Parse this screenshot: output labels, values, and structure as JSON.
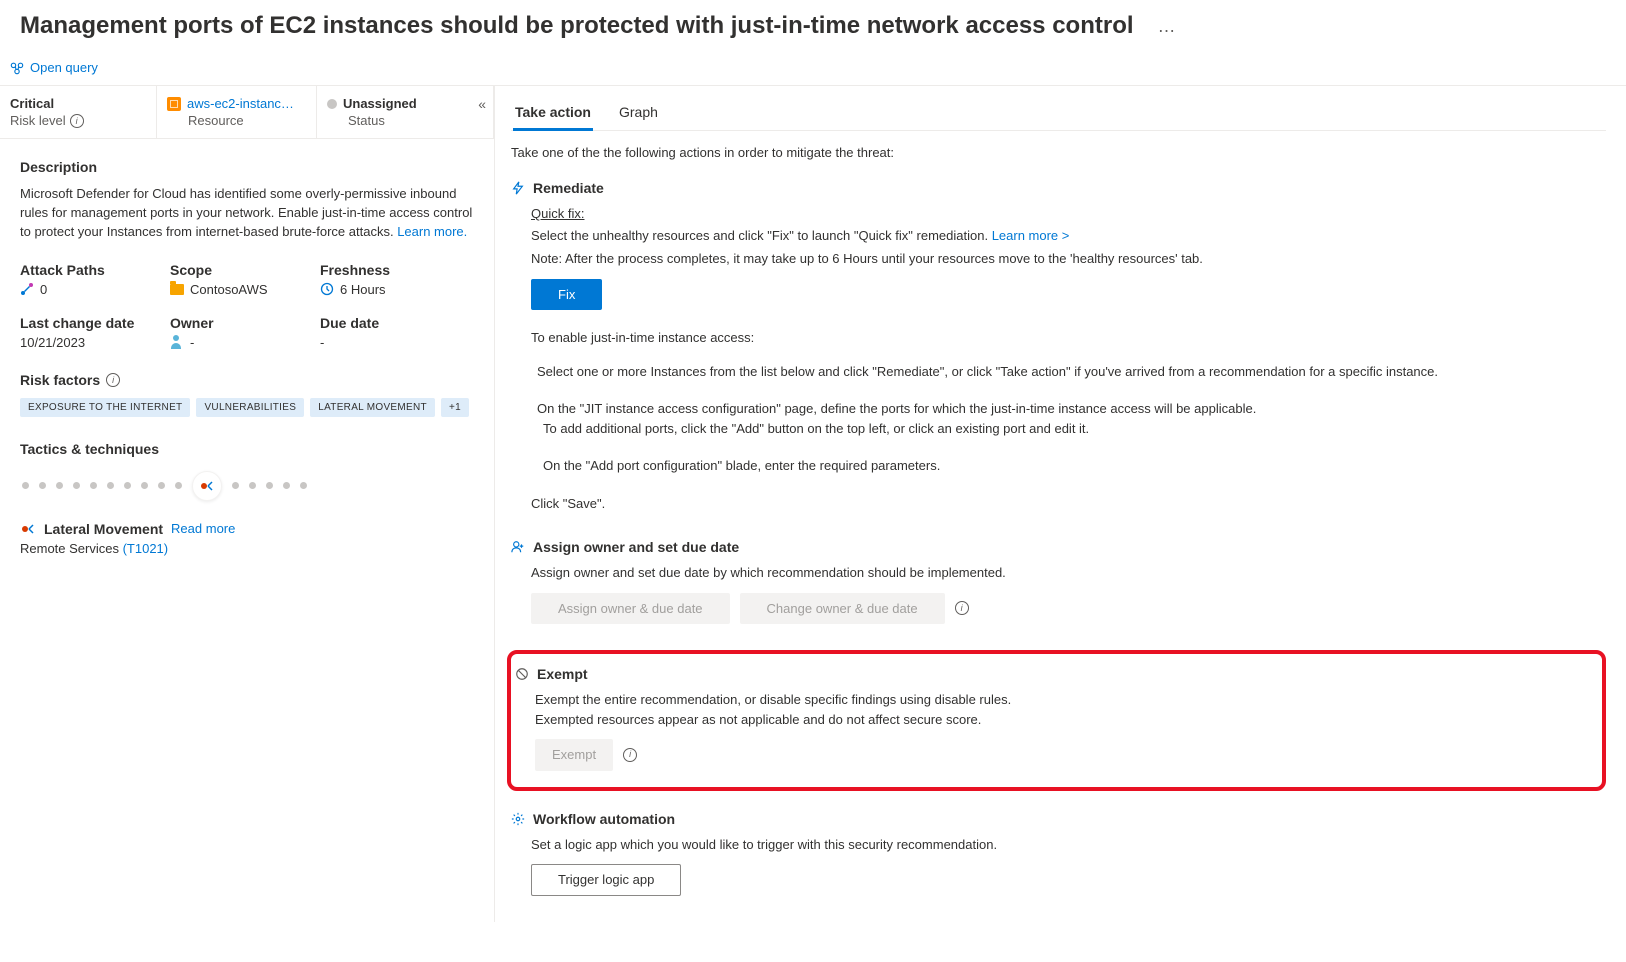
{
  "header": {
    "title": "Management ports of EC2 instances should be protected with just-in-time network access control",
    "ellipsis": "…",
    "open_query": "Open query"
  },
  "info_strip": {
    "risk_level": {
      "value": "Critical",
      "label": "Risk level"
    },
    "resource": {
      "value": "aws-ec2-instanc…",
      "label": "Resource"
    },
    "status": {
      "value": "Unassigned",
      "label": "Status"
    }
  },
  "left": {
    "description_h": "Description",
    "description": "Microsoft Defender for Cloud has identified some overly-permissive inbound rules for management ports in your network. Enable just-in-time access control to protect your Instances from internet-based brute-force attacks. ",
    "learn_more": "Learn more.",
    "meta": {
      "attack_paths": {
        "label": "Attack Paths",
        "value": "0"
      },
      "scope": {
        "label": "Scope",
        "value": "ContosoAWS"
      },
      "freshness": {
        "label": "Freshness",
        "value": "6 Hours"
      },
      "last_change": {
        "label": "Last change date",
        "value": "10/21/2023"
      },
      "owner": {
        "label": "Owner",
        "value": "-"
      },
      "due_date": {
        "label": "Due date",
        "value": "-"
      }
    },
    "risk_factors_label": "Risk factors",
    "risk_tags": [
      "EXPOSURE TO THE INTERNET",
      "VULNERABILITIES",
      "LATERAL MOVEMENT",
      "+1"
    ],
    "tactics_label": "Tactics & techniques",
    "lateral_movement": "Lateral Movement",
    "read_more": "Read more",
    "remote_services": "Remote Services ",
    "remote_services_id": "(T1021)"
  },
  "right": {
    "tabs": {
      "take_action": "Take action",
      "graph": "Graph"
    },
    "intro": "Take one of the the following actions in order to mitigate the threat:",
    "remediate": {
      "title": "Remediate",
      "quick_fix_label": "Quick fix:",
      "line1a": "Select the unhealthy resources and click \"Fix\" to launch \"Quick fix\" remediation. ",
      "learn_more": "Learn more >",
      "line2": "Note: After the process completes, it may take up to 6 Hours until your resources move to the 'healthy resources' tab.",
      "fix_btn": "Fix",
      "enable_intro": "To enable just-in-time instance access:",
      "step1": "Select one or more Instances from the list below and click \"Remediate\", or click \"Take action\" if you've arrived from a recommendation for a specific instance.",
      "step2a": "On the \"JIT instance access configuration\" page, define the ports for which the just-in-time instance access will be applicable.",
      "step2b": "To add additional ports, click the \"Add\" button on the top left, or click an existing port and edit it.",
      "step3": "On the \"Add port configuration\" blade, enter the required parameters.",
      "step4": "Click \"Save\"."
    },
    "assign": {
      "title": "Assign owner and set due date",
      "desc": "Assign owner and set due date by which recommendation should be implemented.",
      "btn1": "Assign owner & due date",
      "btn2": "Change owner & due date"
    },
    "exempt": {
      "title": "Exempt",
      "desc1": "Exempt the entire recommendation, or disable specific findings using disable rules.",
      "desc2": "Exempted resources appear as not applicable and do not affect secure score.",
      "btn": "Exempt"
    },
    "workflow": {
      "title": "Workflow automation",
      "desc": "Set a logic app which you would like to trigger with this security recommendation.",
      "btn": "Trigger logic app"
    }
  }
}
